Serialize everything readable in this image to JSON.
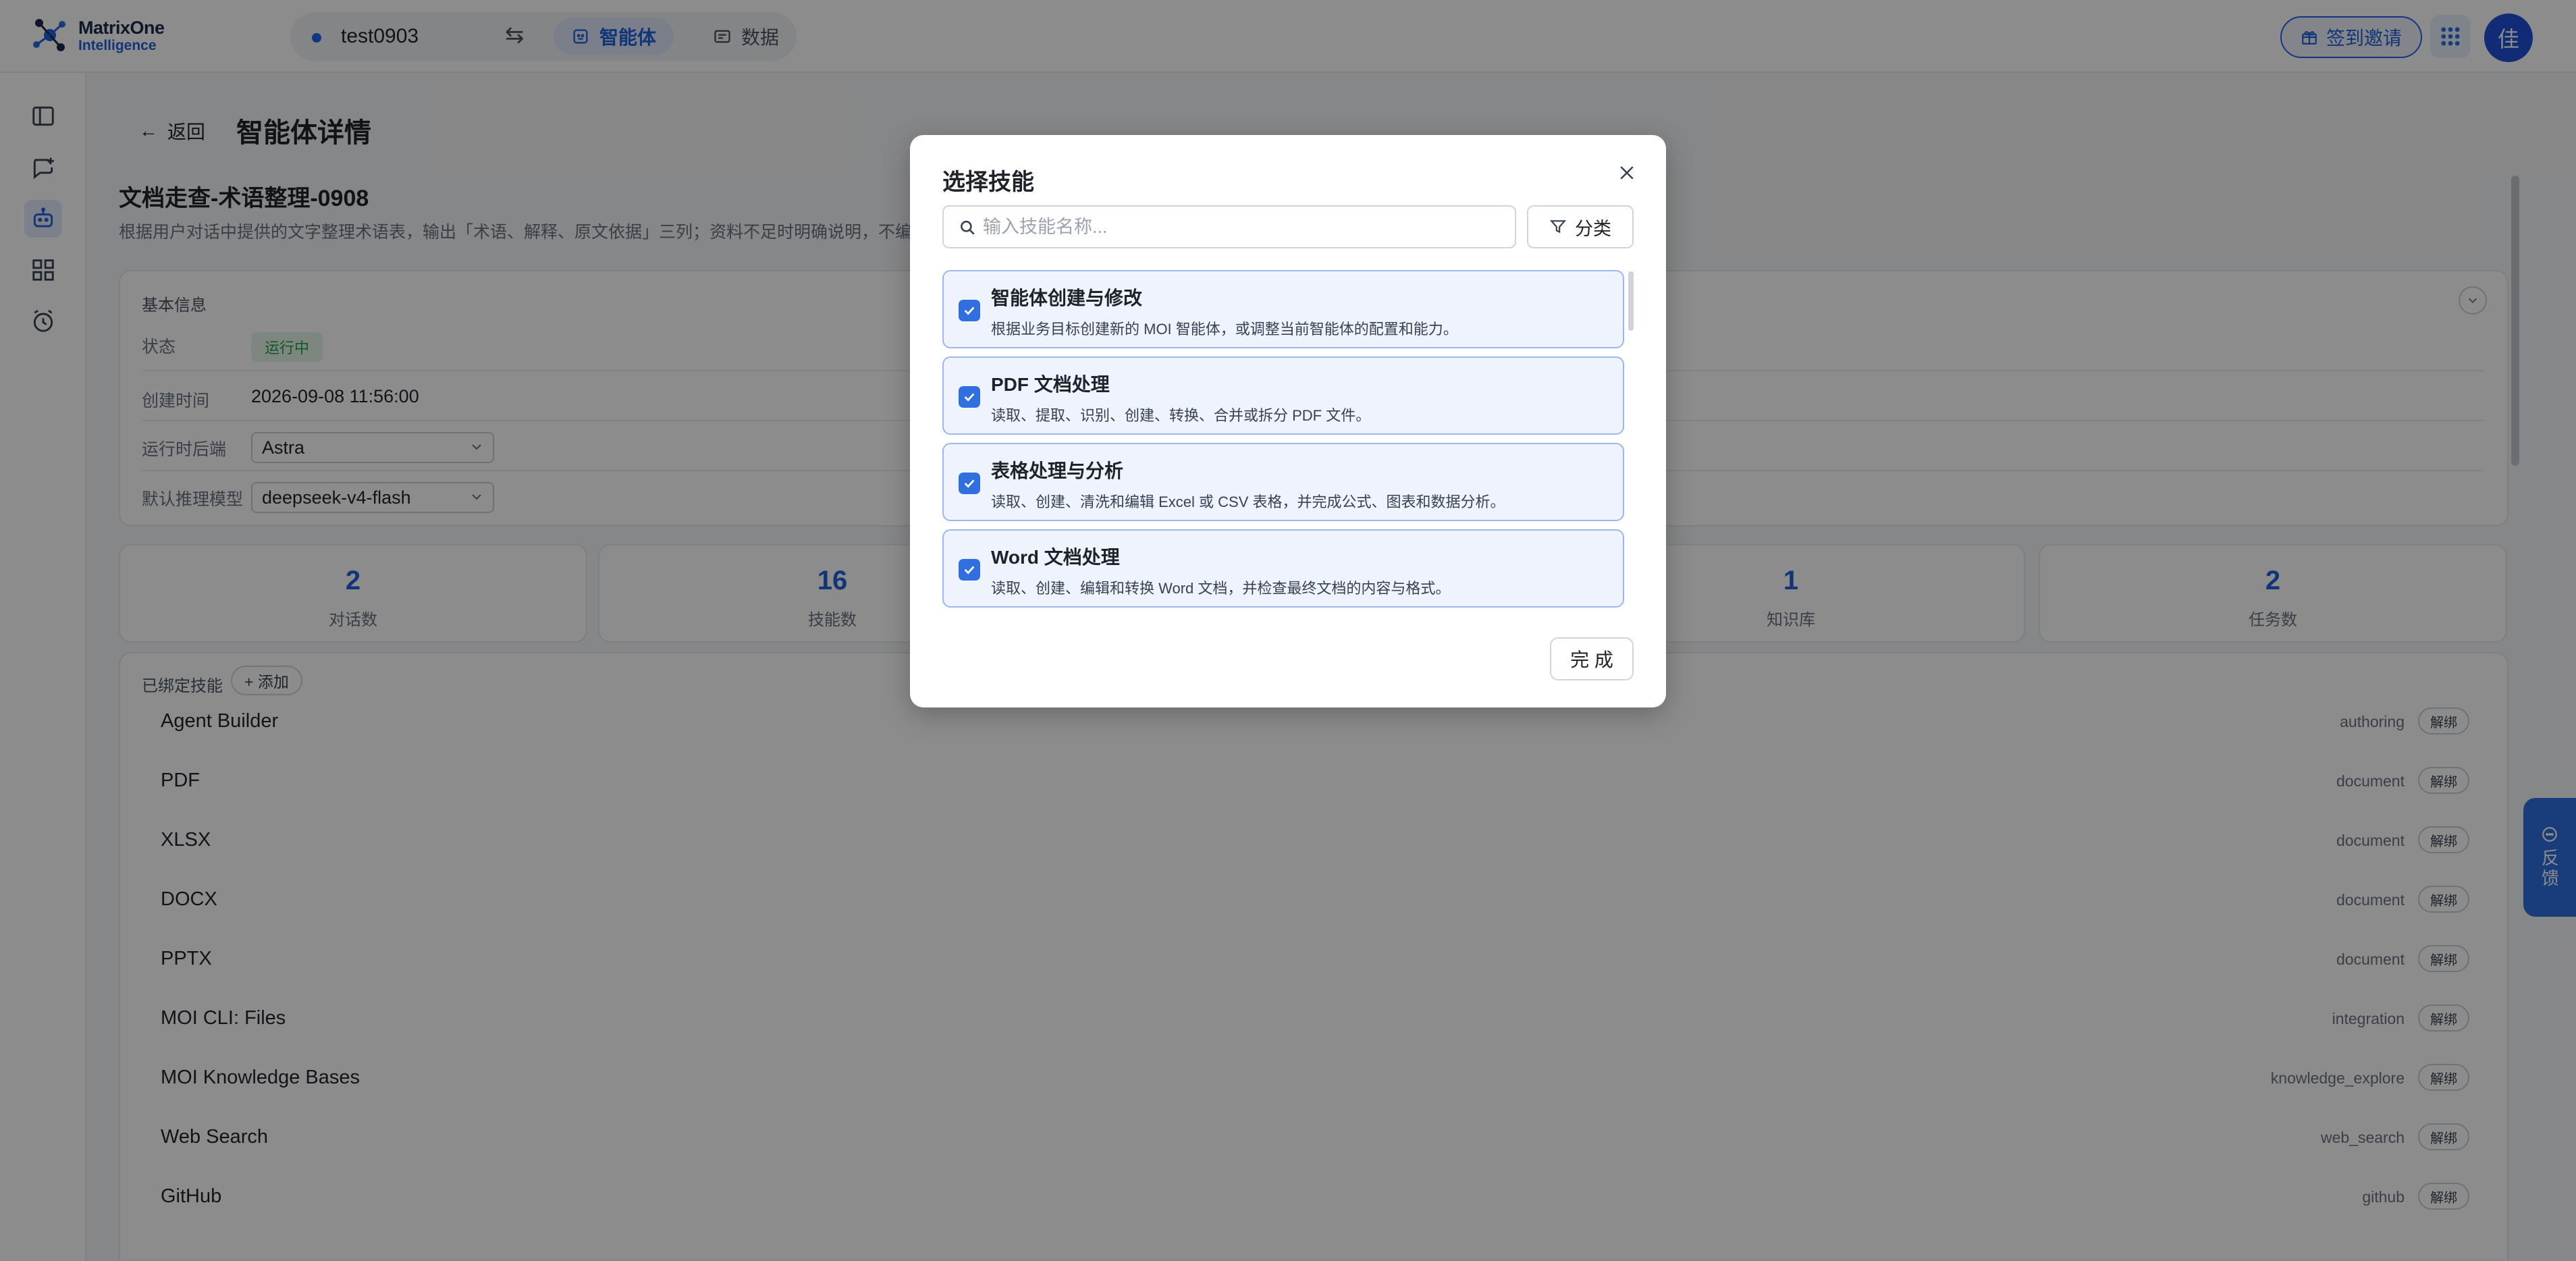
{
  "brand": {
    "line1": "MatrixOne",
    "line2": "Intelligence",
    "accent": "#1f62d8"
  },
  "workspace": {
    "name": "test0903",
    "tabs": [
      {
        "label": "智能体"
      },
      {
        "label": "数据"
      }
    ]
  },
  "header": {
    "invite_label": "签到邀请",
    "avatar_text": "佳"
  },
  "rail": {
    "icons": [
      "sidebar-toggle-icon",
      "new-chat-icon",
      "agent-robot-icon",
      "apps-grid-icon",
      "alarm-clock-icon"
    ]
  },
  "page": {
    "back_label": "返回",
    "title": "智能体详情",
    "agent_name": "文档走查-术语整理-0908",
    "agent_desc": "根据用户对话中提供的文字整理术语表，输出「术语、解释、原文依据」三列；资料不足时明确说明，不编造。"
  },
  "basic_info": {
    "title": "基本信息",
    "status_label": "状态",
    "status_value": "运行中",
    "created_label": "创建时间",
    "created_value": "2026-09-08 11:56:00",
    "runtime_label": "运行时后端",
    "runtime_value": "Astra",
    "model_label": "默认推理模型",
    "model_value": "deepseek-v4-flash"
  },
  "stats": [
    {
      "value": "2",
      "label": "对话数"
    },
    {
      "value": "16",
      "label": "技能数"
    },
    {
      "value": "1",
      "label": "知识库"
    },
    {
      "value": "2",
      "label": "任务数"
    }
  ],
  "bound_skills": {
    "title": "已绑定技能",
    "add_label": "+ 添加",
    "unbind_label": "解绑",
    "items": [
      {
        "name": "Agent Builder",
        "category": "authoring"
      },
      {
        "name": "PDF",
        "category": "document"
      },
      {
        "name": "XLSX",
        "category": "document"
      },
      {
        "name": "DOCX",
        "category": "document"
      },
      {
        "name": "PPTX",
        "category": "document"
      },
      {
        "name": "MOI CLI: Files",
        "category": "integration"
      },
      {
        "name": "MOI Knowledge Bases",
        "category": "knowledge_explore"
      },
      {
        "name": "Web Search",
        "category": "web_search"
      },
      {
        "name": "GitHub",
        "category": "github"
      }
    ]
  },
  "feedback_label": "反馈",
  "modal": {
    "title": "选择技能",
    "search_placeholder": "输入技能名称...",
    "category_label": "分类",
    "done_label": "完 成",
    "options": [
      {
        "title": "智能体创建与修改",
        "desc": "根据业务目标创建新的 MOI 智能体，或调整当前智能体的配置和能力。",
        "checked": true
      },
      {
        "title": "PDF 文档处理",
        "desc": "读取、提取、识别、创建、转换、合并或拆分 PDF 文件。",
        "checked": true
      },
      {
        "title": "表格处理与分析",
        "desc": "读取、创建、清洗和编辑 Excel 或 CSV 表格，并完成公式、图表和数据分析。",
        "checked": true
      },
      {
        "title": "Word 文档处理",
        "desc": "读取、创建、编辑和转换 Word 文档，并检查最终文档的内容与格式。",
        "checked": true
      }
    ]
  }
}
